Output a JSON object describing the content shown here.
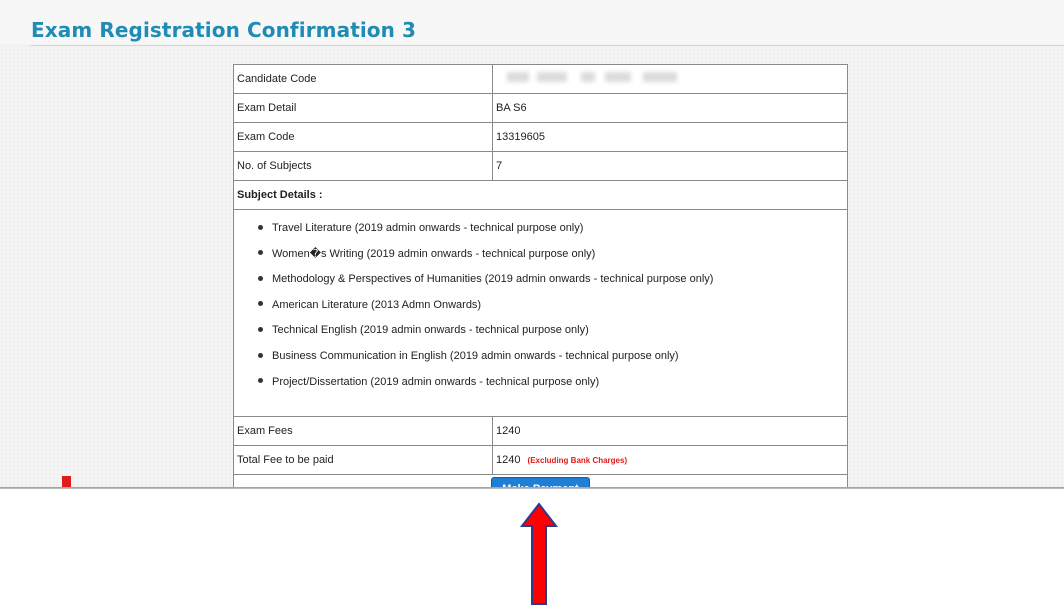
{
  "page": {
    "title": "Exam Registration Confirmation 3"
  },
  "details": [
    {
      "label": "Candidate Code",
      "value": ""
    },
    {
      "label": "Exam Detail",
      "value": "BA S6"
    },
    {
      "label": "Exam Code",
      "value": "13319605"
    },
    {
      "label": "No. of Subjects",
      "value": "7"
    }
  ],
  "subjects": {
    "heading": "Subject Details :",
    "items": [
      "Travel Literature (2019 admin onwards - technical purpose only)",
      "Women�s Writing (2019 admin onwards - technical purpose only)",
      "Methodology & Perspectives of Humanities (2019 admin onwards - technical purpose only)",
      "American Literature (2013 Admn Onwards)",
      "Technical English (2019 admin onwards - technical purpose only)",
      "Business Communication in English (2019 admin onwards - technical purpose only)",
      "Project/Dissertation (2019 admin onwards - technical purpose only)"
    ]
  },
  "fees": {
    "exam_fees_label": "Exam Fees",
    "exam_fees_value": "1240",
    "total_label": "Total Fee to be paid",
    "total_value": "1240",
    "total_note": "(Excluding Bank Charges)"
  },
  "actions": {
    "make_payment_label": "Make Payment"
  },
  "colors": {
    "title": "#1e8cb4",
    "button": "#1f7fd4",
    "note": "#e01b1b",
    "arrow_fill": "#ff0000",
    "arrow_outline": "#2b3a8f"
  }
}
